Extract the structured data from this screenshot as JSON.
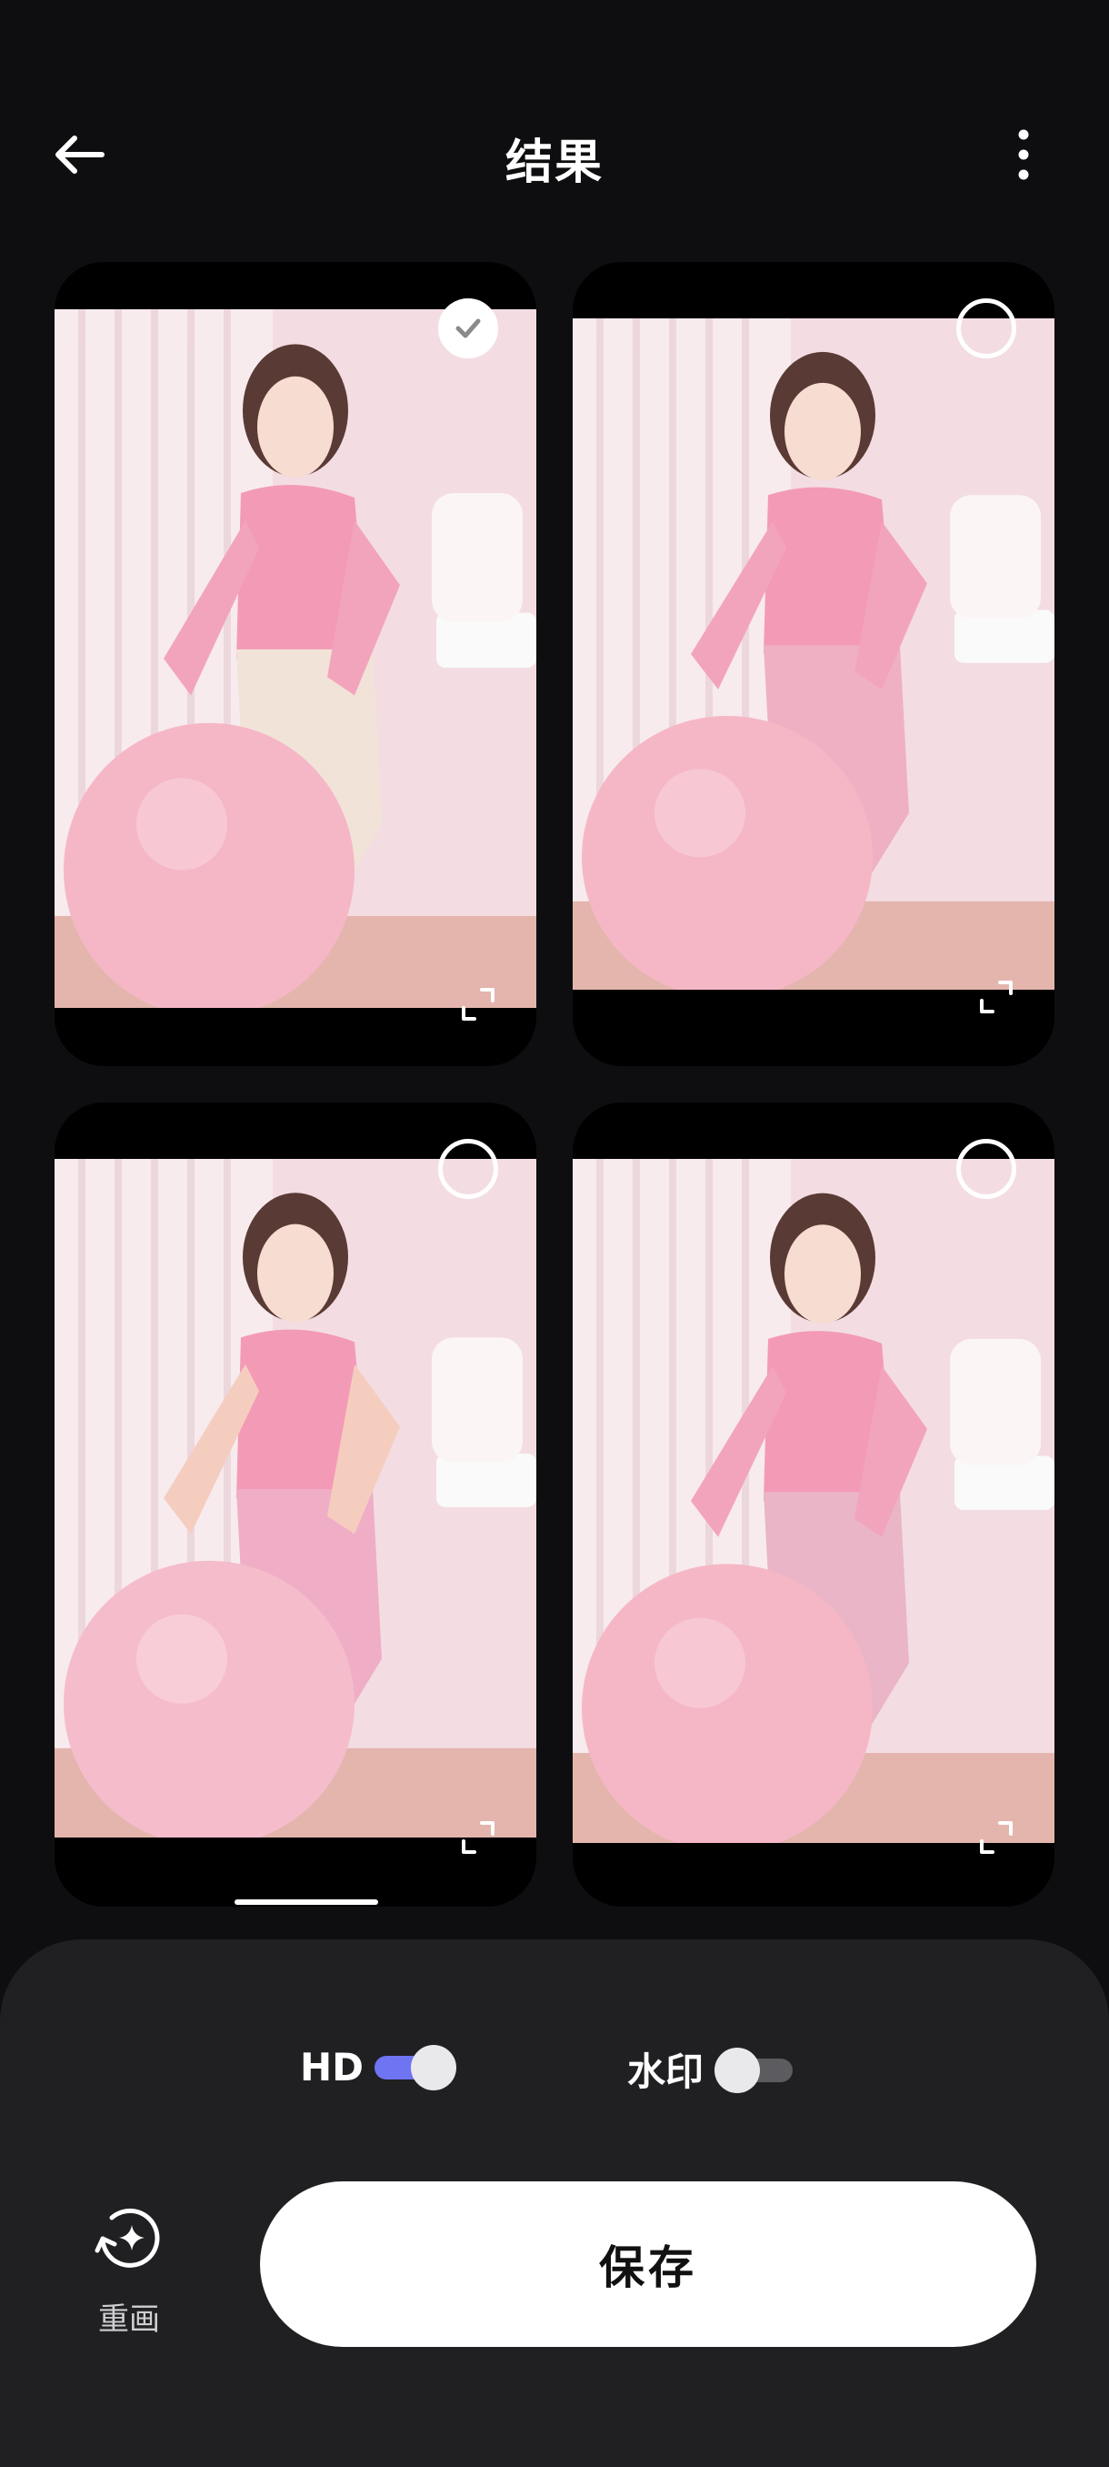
{
  "header": {
    "title": "结果",
    "back_icon": "arrow-left-icon",
    "more_icon": "more-vertical-icon"
  },
  "results": [
    {
      "selected": true,
      "pants_color": "#f1e3d8"
    },
    {
      "selected": false,
      "pants_color": "#efb0c4"
    },
    {
      "selected": false,
      "pants_color": "#efaec6"
    },
    {
      "selected": false,
      "pants_color": "#e9b5c7"
    }
  ],
  "toggles": {
    "hd": {
      "label": "HD",
      "on": true,
      "accent": "#6f74f2"
    },
    "watermark": {
      "label": "水印",
      "on": false
    }
  },
  "actions": {
    "redraw_label": "重画",
    "save_label": "保存"
  }
}
